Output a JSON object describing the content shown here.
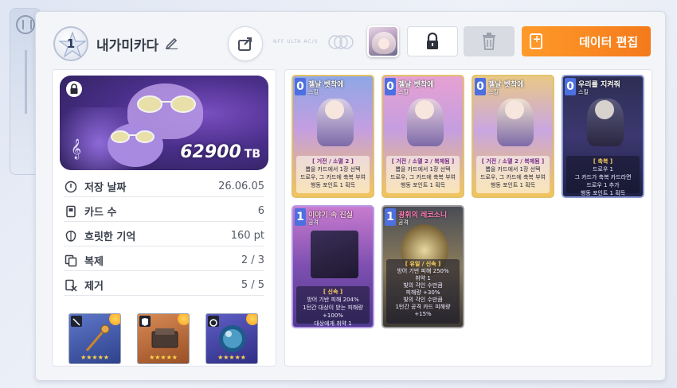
{
  "header": {
    "rank": "1",
    "deck_name": "내가미카다",
    "watermark": "NFF ULTA AC/S",
    "edit_button_label": "데이터 편집"
  },
  "banner": {
    "score": "62900",
    "unit": "TB"
  },
  "stats": [
    {
      "icon": "clock-icon",
      "label": "저장 날짜",
      "value": "26.06.05"
    },
    {
      "icon": "card-icon",
      "label": "카드 수",
      "value": "6"
    },
    {
      "icon": "brain-icon",
      "label": "흐릿한 기억",
      "value": "160 pt"
    },
    {
      "icon": "copy-icon",
      "label": "복제",
      "value": "2 / 3"
    },
    {
      "icon": "remove-icon",
      "label": "제거",
      "value": "5 / 5"
    }
  ],
  "equipment": [
    {
      "icon": "sword-icon",
      "stars": "★★★★★",
      "color": "#3f5aa8"
    },
    {
      "icon": "armor-icon",
      "stars": "★★★★★",
      "color": "#b86a3a"
    },
    {
      "icon": "ring-icon",
      "stars": "★★★★★",
      "color": "#4b4aa3"
    }
  ],
  "cards": [
    {
      "cost": "0",
      "title": "젤날 벳착에",
      "type": "스킬",
      "tag": "[ 거전 / 소멸 2 ]",
      "lines": [
        "뽑을 카드에서 1장 선택",
        "드로우, 그 카드에 축복 부여",
        "행동 포인트 1 획득"
      ],
      "theme": "gold"
    },
    {
      "cost": "0",
      "title": "젤날 벳착에",
      "type": "스킬",
      "tag": "[ 거전 / 소멸 2 / 복제됨 ]",
      "lines": [
        "뽑을 카드에서 1장 선택",
        "드로우, 그 카드에 축복 부여",
        "행동 포인트 1 획득"
      ],
      "theme": "gold"
    },
    {
      "cost": "0",
      "title": "젤날 벳착에",
      "type": "스킬",
      "tag": "[ 거전 / 소멸 2 / 복제됨 ]",
      "lines": [
        "뽑을 카드에서 1장 선택",
        "드로우, 그 카드에 축복 부여",
        "행동 포인트 1 획득"
      ],
      "theme": "gold"
    },
    {
      "cost": "0",
      "title": "우리를 지켜줘",
      "type": "스킬",
      "tag": "[ 축복 ]",
      "lines": [
        "드로우 1",
        "그 카드가 축복 카드라면",
        "드로우 1 추가",
        "행동 포인트 1 획득"
      ],
      "theme": "dark"
    },
    {
      "cost": "1",
      "title": "이야기 속 진실",
      "type": "공격",
      "tag": "[ 신속 ]",
      "lines": [
        "방어 기반 피해 204%",
        "1턴간 대상이 받는 피해량",
        "+100%",
        "대상에게 취약 1"
      ],
      "theme": "pink"
    },
    {
      "cost": "1",
      "title": "광휘의 레코소니",
      "type": "공격",
      "tag": "[ 유일 / 신속 ]",
      "lines": [
        "방어 기반 피해 250%",
        "취약 1",
        "빛의 각인 수만큼",
        "피해량 +30%",
        "빛의 각인 수만큼",
        "1턴간 공격 카드 피해량",
        "+15%"
      ],
      "theme": "ornate"
    }
  ],
  "colors": {
    "accent_orange": "#f47a1c",
    "banner_purple": "#4a2f8a",
    "cost_blue": "#4d6fe0"
  }
}
